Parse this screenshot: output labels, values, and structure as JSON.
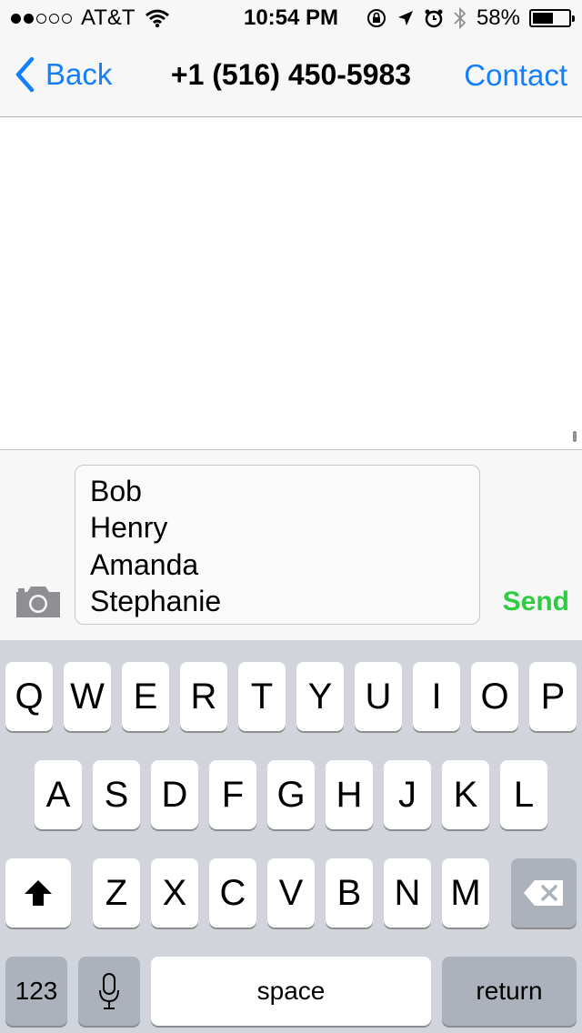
{
  "status_bar": {
    "carrier": "AT&T",
    "time": "10:54 PM",
    "battery": "58%",
    "battery_level": 0.58,
    "signal_bars_filled": 2,
    "signal_bars_total": 5
  },
  "nav": {
    "back_label": "Back",
    "title": "+1 (516) 450-5983",
    "contact_label": "Contact"
  },
  "compose": {
    "lines": [
      "Bob",
      "Henry",
      "Amanda",
      "Stephanie"
    ],
    "send_label": "Send",
    "send_color": "#2ecc40"
  },
  "keyboard": {
    "row1": [
      "Q",
      "W",
      "E",
      "R",
      "T",
      "Y",
      "U",
      "I",
      "O",
      "P"
    ],
    "row2": [
      "A",
      "S",
      "D",
      "F",
      "G",
      "H",
      "J",
      "K",
      "L"
    ],
    "row3": [
      "Z",
      "X",
      "C",
      "V",
      "B",
      "N",
      "M"
    ],
    "numbers_label": "123",
    "space_label": "space",
    "return_label": "return"
  },
  "colors": {
    "accent": "#147efb",
    "keyboard_bg": "#d1d5db"
  }
}
